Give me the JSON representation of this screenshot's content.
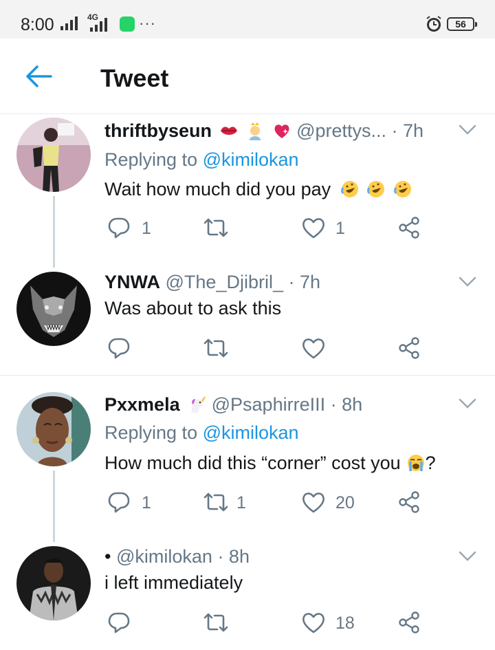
{
  "status_bar": {
    "time": "8:00",
    "network": "4G",
    "battery": "56"
  },
  "header": {
    "title": "Tweet"
  },
  "tweets": [
    {
      "name": "thriftbyseun",
      "handle": "@prettys...",
      "time": "· 7h",
      "replying_prefix": "Replying to",
      "replying_to": "@kimilokan",
      "text": "Wait how much did you pay",
      "reply_count": "1",
      "retweet_count": "",
      "like_count": "1"
    },
    {
      "name": "YNWA",
      "handle": "@The_Djibril_",
      "time": "· 7h",
      "text": "Was about to ask this",
      "reply_count": "",
      "retweet_count": "",
      "like_count": ""
    },
    {
      "name": "Pxxmela",
      "handle": "@PsaphirreIII",
      "time": "· 8h",
      "replying_prefix": "Replying to",
      "replying_to": "@kimilokan",
      "text": "How much did this “corner” cost you",
      "text_suffix": "?",
      "reply_count": "1",
      "retweet_count": "1",
      "like_count": "20"
    },
    {
      "name": "•",
      "handle": "@kimilokan",
      "time": "· 8h",
      "text": "i left immediately",
      "reply_count": "",
      "retweet_count": "",
      "like_count": "18"
    }
  ],
  "colors": {
    "accent": "#1b95e0",
    "muted": "#657786",
    "text": "#14171a",
    "thread_line": "#ccd6dd"
  },
  "icons": [
    "back-arrow-icon",
    "reply-icon",
    "retweet-icon",
    "like-icon",
    "share-icon",
    "chevron-down-icon"
  ]
}
